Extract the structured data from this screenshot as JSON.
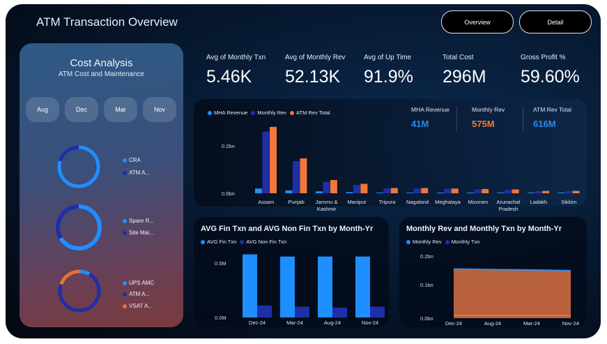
{
  "header": {
    "title": "ATM Transaction Overview",
    "nav": [
      "Overview",
      "Detail"
    ]
  },
  "cost_analysis": {
    "title": "Cost Analysis",
    "subtitle": "ATM Cost and Maintenance",
    "months": [
      "Aug",
      "Dec",
      "Mar",
      "Nov"
    ],
    "donuts": [
      {
        "legend": [
          {
            "label": "CRA",
            "color": "#1f8fff"
          },
          {
            "label": "ATM A...",
            "color": "#1e2fa8"
          }
        ]
      },
      {
        "legend": [
          {
            "label": "Spare R...",
            "color": "#1f8fff"
          },
          {
            "label": "Site Mai...",
            "color": "#1e2fa8"
          }
        ]
      },
      {
        "legend": [
          {
            "label": "UPS AMC",
            "color": "#1f8fff"
          },
          {
            "label": "ATM A...",
            "color": "#1e2fa8"
          },
          {
            "label": "VSAT A...",
            "color": "#e8703a"
          }
        ]
      }
    ]
  },
  "kpis": [
    {
      "label": "Avg of Monthly Txn",
      "value": "5.46K"
    },
    {
      "label": "Avg of Monthly Rev",
      "value": "52.13K"
    },
    {
      "label": "Avg of Up Time",
      "value": "91.9%"
    },
    {
      "label": "Total Cost",
      "value": "296M"
    },
    {
      "label": "Gross Profit %",
      "value": "59.60%"
    }
  ],
  "state_chart": {
    "legend": [
      "MHA Revenue",
      "Monthly Rev",
      "ATM Rev Total"
    ],
    "summary": [
      {
        "label": "MHA Revenue",
        "value": "41M",
        "color": "#2a8cf0"
      },
      {
        "label": "Monthly Rev",
        "value": "575M",
        "color": "#f07a3a"
      },
      {
        "label": "ATM Rev Total",
        "value": "616M",
        "color": "#2a8cf0"
      }
    ]
  },
  "fin_chart": {
    "title": "AVG Fin Txn and AVG Non Fin Txn by Month-Yr",
    "legend": [
      "AVG Fin Txn",
      "AVG Non Fin Txn"
    ]
  },
  "rev_chart": {
    "title": "Monthly Rev and Monthly Txn by Month-Yr",
    "legend": [
      "Monthly Rev",
      "Monthly Txn"
    ]
  },
  "colors": {
    "mha": "#1f8fff",
    "monthly_rev": "#1e2fa8",
    "atm_rev_total": "#f0763a",
    "fin": "#1f8fff",
    "non_fin": "#1e2fa8",
    "area": "#c8693f"
  },
  "chart_data": [
    {
      "type": "bar",
      "categories": [
        "Assam",
        "Punjab",
        "Jammu & Kashmir",
        "Manipur",
        "Tripura",
        "Nagaland",
        "Meghalaya",
        "Mizoram",
        "Arunachal Pradesh",
        "Ladakh",
        "Sikkim"
      ],
      "series": [
        {
          "name": "MHA Revenue",
          "values": [
            0.02,
            0.012,
            0.008,
            0.005,
            0.002,
            0.002,
            0.002,
            0.002,
            0.002,
            0.001,
            0.001
          ]
        },
        {
          "name": "Monthly Rev",
          "values": [
            0.26,
            0.135,
            0.048,
            0.035,
            0.02,
            0.02,
            0.018,
            0.016,
            0.014,
            0.009,
            0.009
          ]
        },
        {
          "name": "ATM Rev Total",
          "values": [
            0.28,
            0.147,
            0.056,
            0.04,
            0.022,
            0.022,
            0.02,
            0.018,
            0.016,
            0.01,
            0.01
          ]
        }
      ],
      "yticks": [
        "0.0bn",
        "0.2bn"
      ],
      "ylim": [
        0,
        0.3
      ]
    },
    {
      "type": "bar",
      "title": "AVG Fin Txn and AVG Non Fin Txn by Month-Yr",
      "categories": [
        "Dec-24",
        "Mar-24",
        "Aug-24",
        "Nov-24"
      ],
      "series": [
        {
          "name": "AVG Fin Txn",
          "values": [
            0.58,
            0.56,
            0.56,
            0.56
          ]
        },
        {
          "name": "AVG Non Fin Txn",
          "values": [
            0.11,
            0.1,
            0.09,
            0.1
          ]
        }
      ],
      "yticks": [
        "0.0M",
        "0.5M"
      ],
      "ylim": [
        0,
        0.65
      ]
    },
    {
      "type": "area",
      "title": "Monthly Rev and Monthly Txn by Month-Yr",
      "categories": [
        "Dec-24",
        "Aug-24",
        "Mar-24",
        "Nov-24"
      ],
      "series": [
        {
          "name": "Monthly Rev",
          "values": [
            0.147,
            0.145,
            0.144,
            0.142
          ]
        },
        {
          "name": "Monthly Txn",
          "values": [
            0.001,
            0.001,
            0.001,
            0.001
          ]
        }
      ],
      "yticks": [
        "0.0bn",
        "0.1bn"
      ],
      "ylim": [
        0,
        0.18
      ]
    }
  ]
}
